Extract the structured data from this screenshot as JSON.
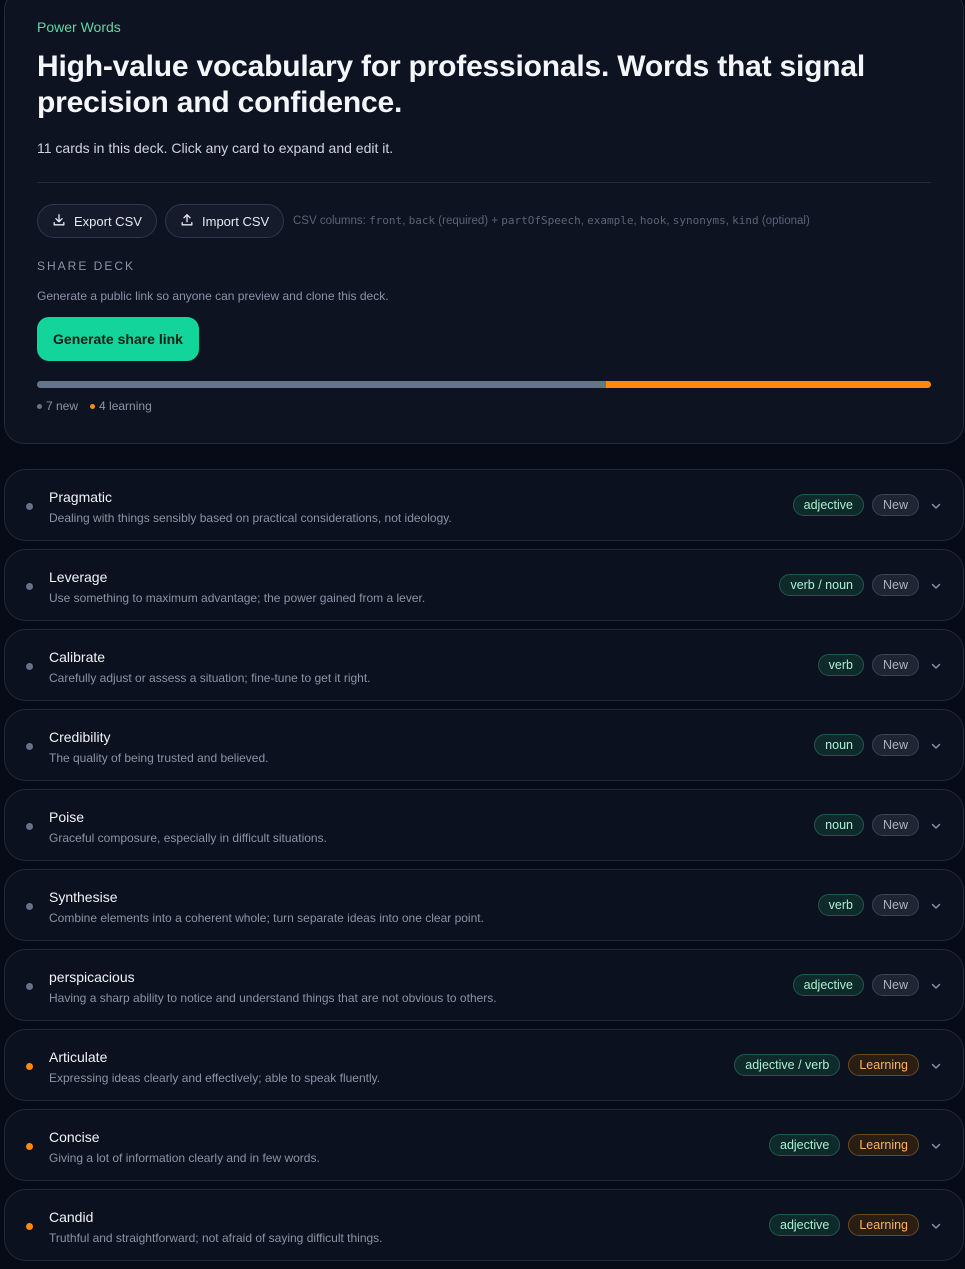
{
  "deck": {
    "label": "Power Words",
    "title": "High-value vocabulary for professionals. Words that signal precision and confidence.",
    "subtitle": "11 cards in this deck. Click any card to expand and edit it."
  },
  "toolbar": {
    "export_label": "Export CSV",
    "import_label": "Import CSV",
    "csv_hint_prefix": "CSV columns:",
    "csv_required_cols": [
      "front",
      "back"
    ],
    "csv_required_note": "(required) +",
    "csv_optional_cols": [
      "partOfSpeech",
      "example",
      "hook",
      "synonyms",
      "kind"
    ],
    "csv_optional_note": "(optional)"
  },
  "share": {
    "heading": "SHARE DECK",
    "description": "Generate a public link so anyone can preview and clone this deck.",
    "button_label": "Generate share link"
  },
  "progress": {
    "new_count": 7,
    "learning_count": 4,
    "new_label": "7 new",
    "learning_label": "4 learning",
    "colors": {
      "new": "#66748a",
      "learning": "#ff8a0a"
    }
  },
  "cards": [
    {
      "word": "Pragmatic",
      "definition": "Dealing with things sensibly based on practical considerations, not ideology.",
      "pos": "adjective",
      "status": "New"
    },
    {
      "word": "Leverage",
      "definition": "Use something to maximum advantage; the power gained from a lever.",
      "pos": "verb / noun",
      "status": "New"
    },
    {
      "word": "Calibrate",
      "definition": "Carefully adjust or assess a situation; fine-tune to get it right.",
      "pos": "verb",
      "status": "New"
    },
    {
      "word": "Credibility",
      "definition": "The quality of being trusted and believed.",
      "pos": "noun",
      "status": "New"
    },
    {
      "word": "Poise",
      "definition": "Graceful composure, especially in difficult situations.",
      "pos": "noun",
      "status": "New"
    },
    {
      "word": "Synthesise",
      "definition": "Combine elements into a coherent whole; turn separate ideas into one clear point.",
      "pos": "verb",
      "status": "New"
    },
    {
      "word": "perspicacious",
      "definition": "Having a sharp ability to notice and understand things that are not obvious to others.",
      "pos": "adjective",
      "status": "New"
    },
    {
      "word": "Articulate",
      "definition": "Expressing ideas clearly and effectively; able to speak fluently.",
      "pos": "adjective / verb",
      "status": "Learning"
    },
    {
      "word": "Concise",
      "definition": "Giving a lot of information clearly and in few words.",
      "pos": "adjective",
      "status": "Learning"
    },
    {
      "word": "Candid",
      "definition": "Truthful and straightforward; not afraid of saying difficult things.",
      "pos": "adjective",
      "status": "Learning"
    }
  ],
  "icons": {
    "export": "download-icon",
    "import": "upload-icon",
    "expand": "chevron-down-icon"
  }
}
